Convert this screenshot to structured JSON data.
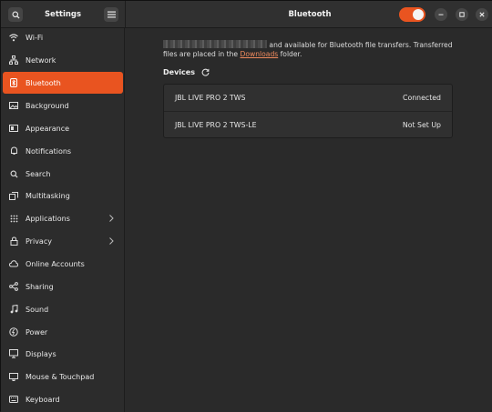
{
  "header": {
    "app_title": "Settings",
    "page_title": "Bluetooth",
    "bluetooth_toggle": "on",
    "accent_color": "#e95420"
  },
  "sidebar": {
    "items": [
      {
        "label": "Wi-Fi",
        "icon": "wifi-icon"
      },
      {
        "label": "Network",
        "icon": "network-icon"
      },
      {
        "label": "Bluetooth",
        "icon": "bluetooth-icon",
        "active": true
      },
      {
        "label": "Background",
        "icon": "background-icon"
      },
      {
        "label": "Appearance",
        "icon": "appearance-icon"
      },
      {
        "label": "Notifications",
        "icon": "bell-icon"
      },
      {
        "label": "Search",
        "icon": "search-icon"
      },
      {
        "label": "Multitasking",
        "icon": "multitasking-icon"
      },
      {
        "label": "Applications",
        "icon": "grid-icon",
        "has_submenu": true
      },
      {
        "label": "Privacy",
        "icon": "lock-icon",
        "has_submenu": true
      },
      {
        "label": "Online Accounts",
        "icon": "cloud-icon"
      },
      {
        "label": "Sharing",
        "icon": "share-icon"
      },
      {
        "label": "Sound",
        "icon": "music-note-icon"
      },
      {
        "label": "Power",
        "icon": "power-icon"
      },
      {
        "label": "Displays",
        "icon": "display-icon"
      },
      {
        "label": "Mouse & Touchpad",
        "icon": "mouse-icon"
      },
      {
        "label": "Keyboard",
        "icon": "keyboard-icon"
      }
    ]
  },
  "main": {
    "description_after_name": " and available for Bluetooth file transfers. Transferred",
    "description_line2_prefix": "files are placed in the ",
    "downloads_link": "Downloads",
    "description_line2_suffix": " folder.",
    "devices_header": "Devices",
    "devices": [
      {
        "name": "JBL LIVE PRO 2 TWS",
        "status": "Connected"
      },
      {
        "name": "JBL LIVE PRO 2 TWS-LE",
        "status": "Not Set Up"
      }
    ]
  }
}
